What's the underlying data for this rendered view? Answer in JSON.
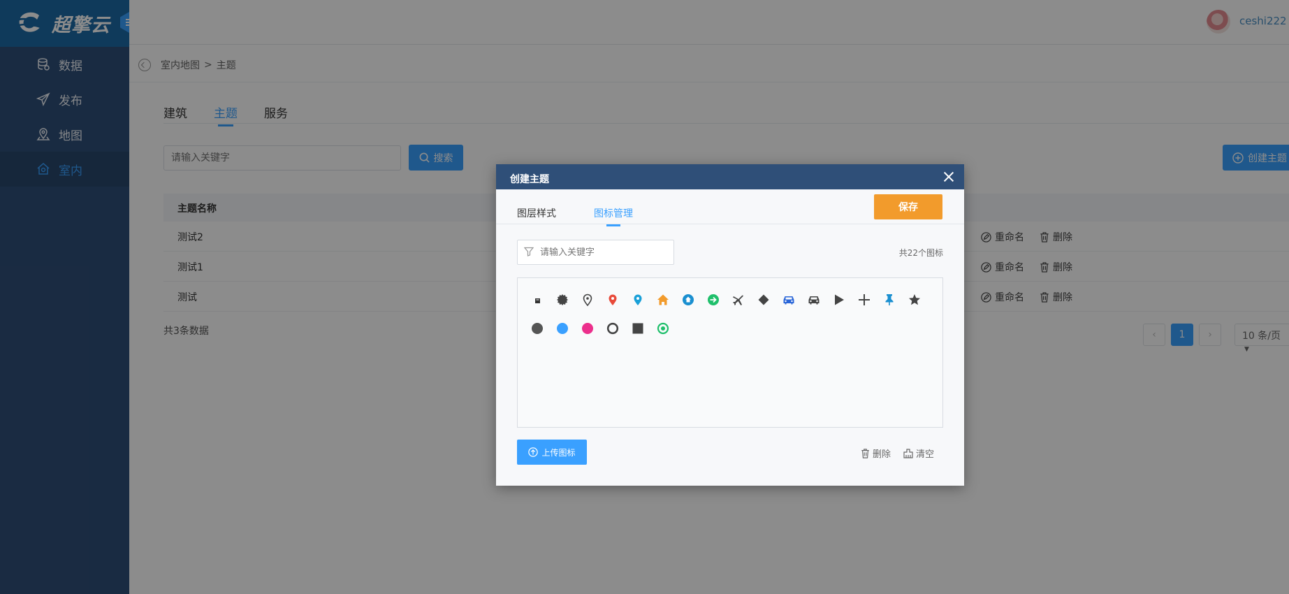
{
  "brand": {
    "name": "超擎云"
  },
  "user": {
    "name": "ceshi222"
  },
  "sidebar": {
    "items": [
      {
        "label": "数据",
        "icon": "database-icon",
        "active": false
      },
      {
        "label": "发布",
        "icon": "send-icon",
        "active": false
      },
      {
        "label": "地图",
        "icon": "map-pin-icon",
        "active": false
      },
      {
        "label": "室内",
        "icon": "indoor-icon",
        "active": true
      }
    ]
  },
  "breadcrumb": {
    "parent": "室内地图",
    "separator": ">",
    "current": "主题"
  },
  "tabs": [
    {
      "label": "建筑",
      "active": false
    },
    {
      "label": "主题",
      "active": true
    },
    {
      "label": "服务",
      "active": false
    }
  ],
  "search": {
    "placeholder": "请输入关键字",
    "button_label": "搜索"
  },
  "create_button_label": "创建主题",
  "table": {
    "header": "主题名称",
    "rows": [
      {
        "name": "测试2"
      },
      {
        "name": "测试1"
      },
      {
        "name": "测试"
      }
    ],
    "rename_label": "重命名",
    "delete_label": "删除"
  },
  "total_text": "共3条数据",
  "pagination": {
    "current_page": "1",
    "page_size": "10 条/页"
  },
  "modal": {
    "title": "创建主题",
    "tabs": [
      {
        "label": "图层样式",
        "active": false
      },
      {
        "label": "图标管理",
        "active": true
      }
    ],
    "save_label": "保存",
    "filter_placeholder": "请输入关键字",
    "count_text": "共22个图标",
    "icons": [
      "small-square-icon",
      "gear-icon",
      "location-pin-outline-icon",
      "location-pin-red-icon",
      "location-pin-blue-icon",
      "home-orange-icon",
      "home-circle-blue-icon",
      "arrow-circle-green-icon",
      "airplane-icon",
      "diamond-icon",
      "car-blue-icon",
      "car-dark-icon",
      "play-icon",
      "plus-icon",
      "pushpin-icon",
      "star-icon",
      "circle-dark-icon",
      "circle-blue-icon",
      "circle-pink-icon",
      "ring-icon",
      "square-icon",
      "target-green-icon"
    ],
    "upload_label": "上传图标",
    "delete_label": "删除",
    "clear_label": "清空"
  },
  "colors": {
    "sidebar": "#2f4f78",
    "logo_bar": "#1d6aa6",
    "accent": "#3aa0ff",
    "save": "#f29b2c"
  }
}
